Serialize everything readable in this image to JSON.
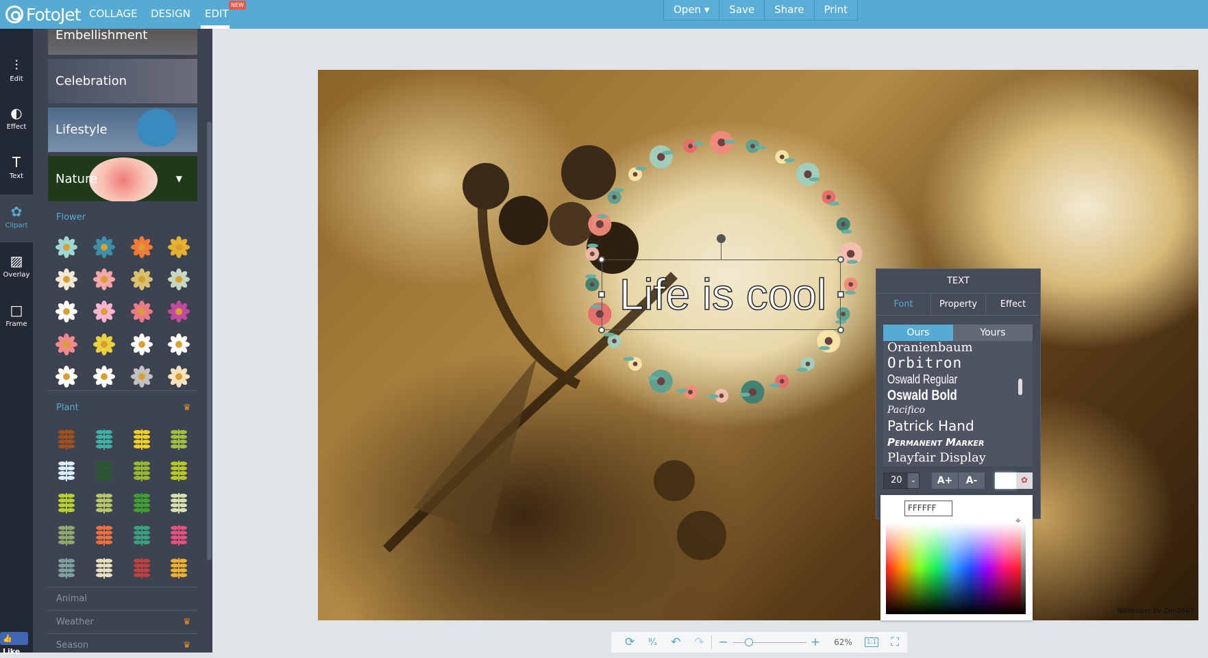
{
  "header": {
    "logo": "FotoJet",
    "nav": [
      "COLLAGE",
      "DESIGN",
      "EDIT"
    ],
    "new_badge": "NEW",
    "buttons": [
      "Open ▾",
      "Save",
      "Share",
      "Print"
    ],
    "accent": "#55abd4"
  },
  "tools": [
    {
      "label": "Edit",
      "icon": "sliders-icon",
      "glyph": "⫶"
    },
    {
      "label": "Effect",
      "icon": "contrast-icon",
      "glyph": "◐"
    },
    {
      "label": "Text",
      "icon": "text-icon",
      "glyph": "T"
    },
    {
      "label": "Clipart",
      "icon": "flower-icon",
      "glyph": "✿"
    },
    {
      "label": "Overlay",
      "icon": "overlay-icon",
      "glyph": "▨"
    },
    {
      "label": "Frame",
      "icon": "frame-icon",
      "glyph": "□"
    }
  ],
  "categories": [
    "Embellishment",
    "Celebration",
    "Lifestyle",
    "Nature"
  ],
  "sections": {
    "flower": "Flower",
    "plant": "Plant",
    "animal": "Animal",
    "weather": "Weather",
    "season": "Season"
  },
  "flower_colors": [
    "#9fd6d6",
    "#3b8fa8",
    "#f07a3a",
    "#e8b030",
    "#f2e6d6",
    "#f4a6a6",
    "#d8c070",
    "#c8d8c0",
    "#ffffff",
    "#f7b6d0",
    "#e87a8a",
    "#c04aa0",
    "#f08a8a",
    "#e8d040",
    "#ffffff",
    "#ffffff",
    "#ffffff",
    "#ffffff",
    "#c0c0c0",
    "#f7e2c0"
  ],
  "plant_colors": [
    "#a0501a",
    "#3fb0a8",
    "#f0d020",
    "#a0c040",
    "#ddeeff",
    "#2a5a2a",
    "#98b830",
    "#b8c820",
    "#b8d030",
    "#b8c868",
    "#40a030",
    "#d8e0b0",
    "#90a870",
    "#f07040",
    "#3aa080",
    "#e85080",
    "#80a0a0",
    "#e8e0c0",
    "#c04040",
    "#f0b030"
  ],
  "like": "Like",
  "canvas": {
    "text": "Life is cool",
    "watermark": "Wallpaper by Zim2687"
  },
  "text_panel": {
    "title": "TEXT",
    "tabs": [
      "Font",
      "Property",
      "Effect"
    ],
    "sources": [
      "Ours",
      "Yours"
    ],
    "fonts": [
      "Oranienbaum",
      "Orbitron",
      "Oswald Regular",
      "Oswald Bold",
      "Pacifico",
      "Patrick Hand",
      "Permanent Marker",
      "Playfair Display"
    ],
    "size": "20",
    "grow": "A+",
    "shrink": "A-",
    "color_hex": "FFFFFF"
  },
  "bottom": {
    "zoom": "62%",
    "fit": "1:1",
    "zoom_level_percent": 62
  }
}
